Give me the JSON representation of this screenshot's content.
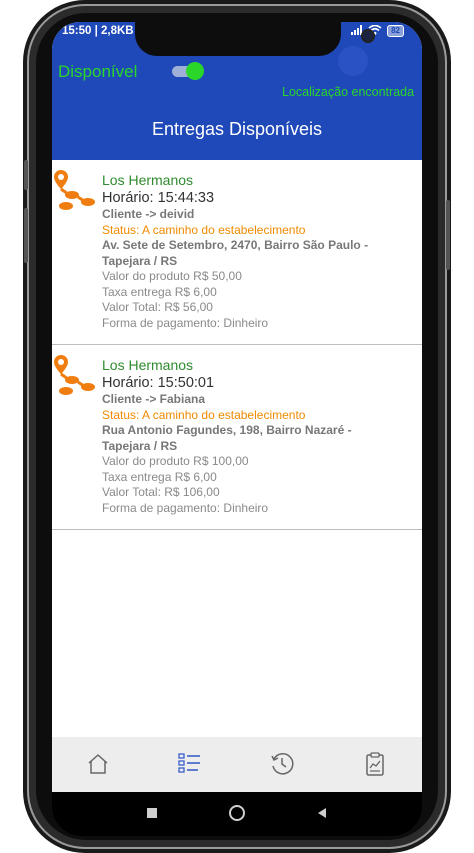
{
  "status_bar": {
    "left_text": "15:50 | 2,8KB",
    "battery": "82"
  },
  "header": {
    "availability_label": "Disponível",
    "availability_on": true,
    "location_status": "Localização encontrada",
    "title": "Entregas Disponíveis"
  },
  "deliveries": [
    {
      "store": "Los Hermanos",
      "time": "Horário: 15:44:33",
      "client": "Cliente -> deivid",
      "status": "Status: A caminho do estabelecimento",
      "address_line1": "Av. Sete de Setembro, 2470, Bairro São Paulo -",
      "address_line2": "Tapejara / RS",
      "product_value": "Valor do produto R$ 50,00",
      "delivery_fee": "Taxa entrega R$ 6,00",
      "total": "Valor Total: R$ 56,00",
      "payment": "Forma de pagamento: Dinheiro"
    },
    {
      "store": "Los Hermanos",
      "time": "Horário: 15:50:01",
      "client": "Cliente -> Fabiana",
      "status": "Status: A caminho do estabelecimento",
      "address_line1": "Rua Antonio Fagundes, 198, Bairro Nazaré -",
      "address_line2": "Tapejara / RS",
      "product_value": "Valor do produto R$ 100,00",
      "delivery_fee": "Taxa entrega R$ 6,00",
      "total": "Valor Total: R$ 106,00",
      "payment": "Forma de pagamento: Dinheiro"
    }
  ],
  "bottom_nav": [
    "home-icon",
    "list-checklist-icon",
    "history-clock-icon",
    "clipboard-report-icon"
  ],
  "colors": {
    "header_blue": "#1f48b8",
    "green": "#2bd62b",
    "store_green": "#2e8b2e",
    "status_orange": "#f08a00",
    "pin_orange": "#f07d10"
  }
}
